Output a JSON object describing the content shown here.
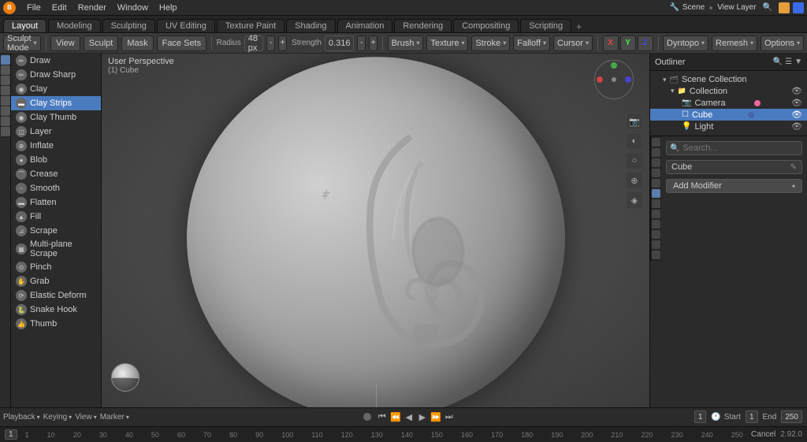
{
  "app": {
    "title": "Blender"
  },
  "top_menu": {
    "items": [
      "File",
      "Edit",
      "Render",
      "Window",
      "Help"
    ]
  },
  "workspace_tabs": {
    "tabs": [
      "Layout",
      "Modeling",
      "Sculpting",
      "UV Editing",
      "Texture Paint",
      "Shading",
      "Animation",
      "Rendering",
      "Compositing",
      "Scripting"
    ],
    "active": "Layout"
  },
  "header_toolbar": {
    "sculpt_mode_label": "Sculpt Mode",
    "view_label": "View",
    "sculpt_label": "Sculpt",
    "mask_label": "Mask",
    "face_sets_label": "Face Sets",
    "radius_label": "Radius",
    "radius_value": "48 px",
    "strength_label": "Strength",
    "strength_value": "0.316",
    "brush_label": "Brush",
    "texture_label": "Texture",
    "stroke_label": "Stroke",
    "falloff_label": "Falloff",
    "cursor_label": "Cursor",
    "dyntopo_label": "Dyntopo",
    "remesh_label": "Remesh",
    "options_label": "Options"
  },
  "brush_list": {
    "header": [
      "Sculpt Mode",
      "View",
      "Sculpt",
      "Mask"
    ],
    "items": [
      {
        "name": "Draw",
        "active": false
      },
      {
        "name": "Draw Sharp",
        "active": false
      },
      {
        "name": "Clay",
        "active": false
      },
      {
        "name": "Clay Strips",
        "active": true
      },
      {
        "name": "Clay Thumb",
        "active": false
      },
      {
        "name": "Layer",
        "active": false
      },
      {
        "name": "Inflate",
        "active": false
      },
      {
        "name": "Blob",
        "active": false
      },
      {
        "name": "Crease",
        "active": false
      },
      {
        "name": "Smooth",
        "active": false
      },
      {
        "name": "Flatten",
        "active": false
      },
      {
        "name": "Fill",
        "active": false
      },
      {
        "name": "Scrape",
        "active": false
      },
      {
        "name": "Multi-plane Scrape",
        "active": false
      },
      {
        "name": "Pinch",
        "active": false
      },
      {
        "name": "Grab",
        "active": false
      },
      {
        "name": "Elastic Deform",
        "active": false
      },
      {
        "name": "Snake Hook",
        "active": false
      },
      {
        "name": "Thumb",
        "active": false
      }
    ]
  },
  "viewport": {
    "mode_label": "User Perspective",
    "object_label": "(1) Cube"
  },
  "scene_outliner": {
    "header": "Scene Collection",
    "items": [
      {
        "name": "Scene Collection",
        "level": 0,
        "icon": "▾"
      },
      {
        "name": "Collection",
        "level": 1,
        "icon": "▾"
      },
      {
        "name": "Camera",
        "level": 2,
        "icon": "📷",
        "selected": false
      },
      {
        "name": "Cube",
        "level": 2,
        "icon": "☐",
        "selected": true
      },
      {
        "name": "Light",
        "level": 2,
        "icon": "💡",
        "selected": false
      }
    ]
  },
  "properties_panel": {
    "object_name": "Cube",
    "modifier_add_label": "Add Modifier",
    "tabs": [
      "🖥",
      "📷",
      "✦",
      "⊞",
      "🔧",
      "👁",
      "💧",
      "🌊",
      "🎨",
      "📦"
    ]
  },
  "timeline": {
    "playback_label": "Playback",
    "keying_label": "Keying",
    "view_label": "View",
    "marker_label": "Marker",
    "frame_current": "1",
    "frame_start_label": "Start",
    "frame_start": "1",
    "frame_end_label": "End",
    "frame_end": "250",
    "ruler_marks": [
      "1",
      "10",
      "20",
      "30",
      "40",
      "50",
      "60",
      "70",
      "80",
      "90",
      "100",
      "110",
      "120",
      "130",
      "140",
      "150",
      "160",
      "170",
      "180",
      "190",
      "200",
      "210",
      "220",
      "230",
      "240",
      "250"
    ]
  },
  "status_bar": {
    "cancel_label": "Cancel",
    "version_label": "2.92.0",
    "frame_indicator": "1"
  }
}
